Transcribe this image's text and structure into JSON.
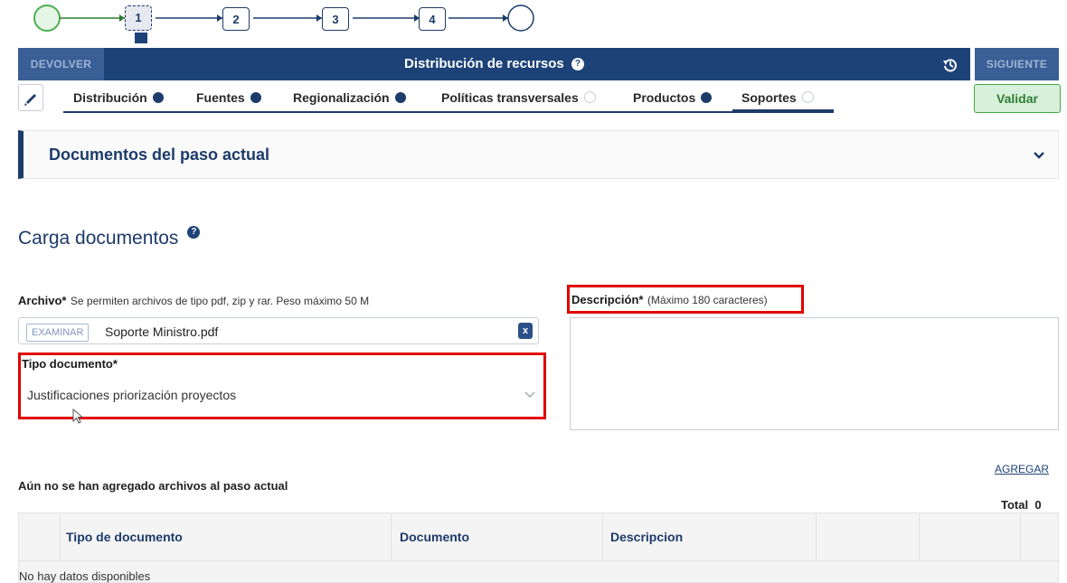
{
  "stepper": {
    "steps": [
      "1",
      "2",
      "3",
      "4"
    ]
  },
  "header": {
    "back_label": "DEVOLVER",
    "title": "Distribución de recursos",
    "next_label": "SIGUIENTE"
  },
  "tabs": [
    {
      "label": "Distribución",
      "status": "complete"
    },
    {
      "label": "Fuentes",
      "status": "complete"
    },
    {
      "label": "Regionalización",
      "status": "complete"
    },
    {
      "label": "Políticas transversales",
      "status": "pending"
    },
    {
      "label": "Productos",
      "status": "complete"
    },
    {
      "label": "Soportes",
      "status": "pending"
    }
  ],
  "validate_label": "Validar",
  "section": {
    "title": "Documentos del paso actual"
  },
  "upload": {
    "heading": "Carga documentos",
    "file_label": "Archivo*",
    "file_hint": "Se permiten archivos de tipo pdf, zip y rar. Peso máximo 50 M",
    "browse_label": "EXAMINAR",
    "file_name": "Soporte Ministro.pdf",
    "clear_label": "x",
    "doc_type_label": "Tipo documento*",
    "doc_type_value": "Justificaciones priorización proyectos",
    "description_label": "Descripción*",
    "description_hint": "(Máximo 180 caracteres)",
    "description_value": ""
  },
  "files": {
    "add_label": "AGREGAR",
    "empty_message": "Aún no se han agregado archivos al paso actual",
    "total_label": "Total",
    "total_count": "0",
    "columns": [
      "Tipo de documento",
      "Documento",
      "Descripcion"
    ],
    "no_data": "No hay datos disponibles"
  },
  "colors": {
    "primary": "#1d4278",
    "accent_green": "#42a84a",
    "highlight_red": "#e00000"
  }
}
